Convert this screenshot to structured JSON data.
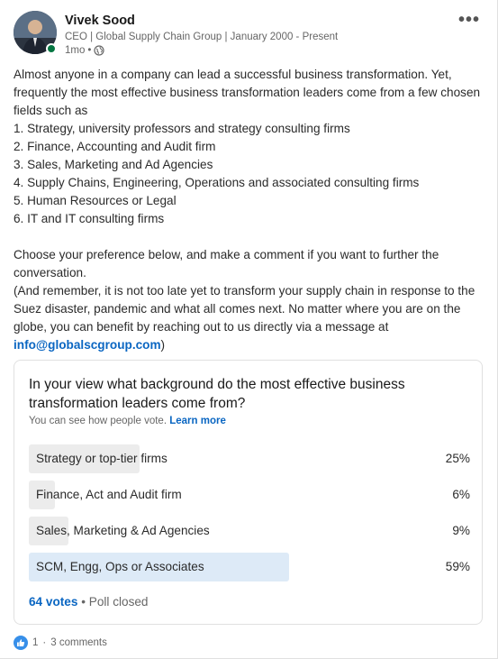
{
  "post": {
    "author": "Vivek Sood",
    "headline": "CEO | Global Supply Chain Group | January 2000 - Present",
    "time": "1mo",
    "bullet": "•",
    "visibility_icon": "globe-icon",
    "more_icon": "•••",
    "intro": "Almost anyone in a company can lead a successful business transformation. Yet, frequently the most effective business transformation leaders come from a few chosen fields such as",
    "list": [
      "1. Strategy, university professors and strategy consulting firms",
      "2. Finance, Accounting and Audit firm",
      "3. Sales, Marketing and Ad Agencies",
      "4. Supply Chains, Engineering, Operations and associated consulting firms",
      "5. Human Resources or Legal",
      "6. IT and IT consulting firms"
    ],
    "para2": "Choose your preference below, and make a comment if you want to further the conversation.",
    "para3": "(And remember, it is not too late yet to transform your supply chain in response to the Suez disaster, pandemic and what all comes next. No matter where you are on the globe, you can benefit by reaching out to us directly via a message at",
    "email": "info@globalscgroup.com",
    "para3_end": ")"
  },
  "poll": {
    "question": "In your view what background do the most effective business transformation leaders come from?",
    "sub_text": "You can see how people vote.",
    "learn_more": "Learn more",
    "options": [
      {
        "label": "Strategy or top-tier firms",
        "percent_text": "25%",
        "percent": 25
      },
      {
        "label": "Finance, Act and Audit firm",
        "percent_text": "6%",
        "percent": 6
      },
      {
        "label": "Sales, Marketing & Ad Agencies",
        "percent_text": "9%",
        "percent": 9
      },
      {
        "label": "SCM, Engg, Ops or Associates",
        "percent_text": "59%",
        "percent": 59
      }
    ],
    "votes": "64 votes",
    "separator": "•",
    "status": "Poll closed"
  },
  "social": {
    "reaction_icon": "thumbs-up-icon",
    "reactions": "1",
    "separator": "·",
    "comments": "3 comments"
  },
  "colors": {
    "link": "#0a66c2",
    "bar_default": "#ececec",
    "bar_winner": "#ddeaf7",
    "presence": "#057642"
  }
}
